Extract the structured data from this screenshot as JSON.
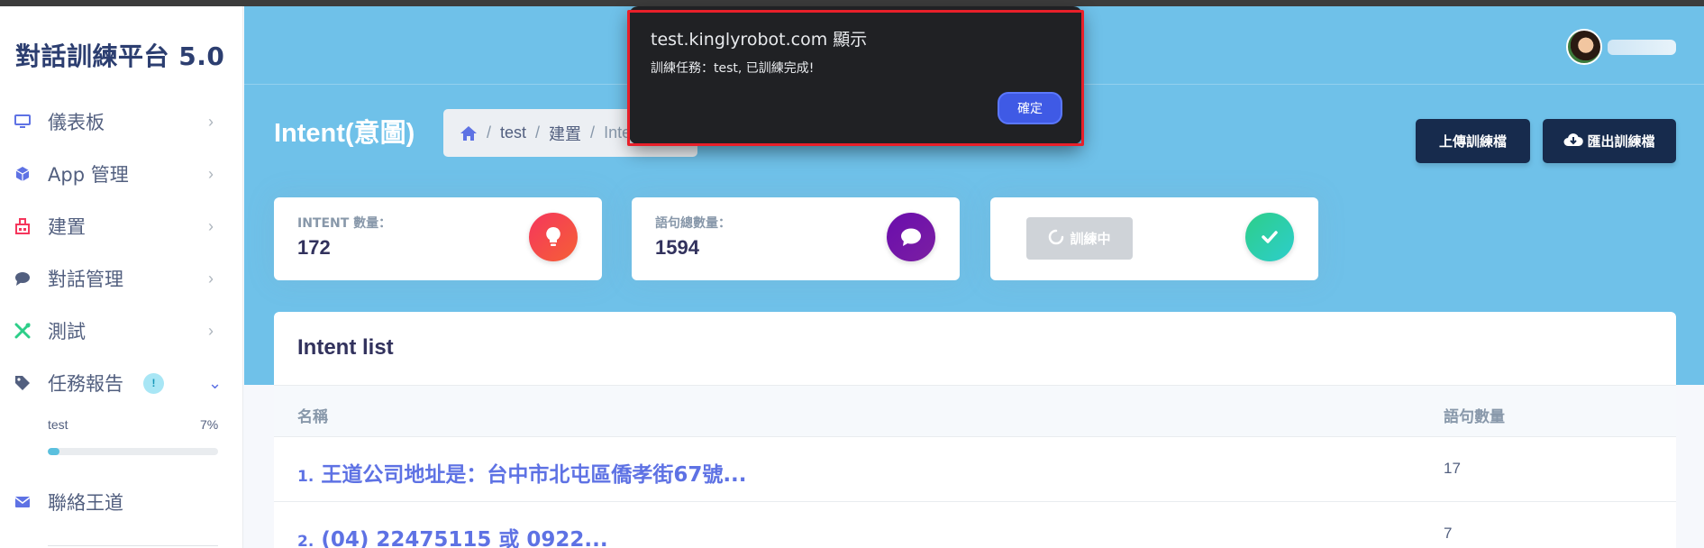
{
  "brand": "對話訓練平台 5.0",
  "sidebar": {
    "items": [
      {
        "label": "儀表板",
        "icon": "monitor-icon",
        "color": "#5e72e4"
      },
      {
        "label": "App 管理",
        "icon": "cube-icon",
        "color": "#5e72e4"
      },
      {
        "label": "建置",
        "icon": "building-icon",
        "color": "#f5365c"
      },
      {
        "label": "對話管理",
        "icon": "chat-icon",
        "color": "#525f7f"
      },
      {
        "label": "測試",
        "icon": "tools-icon",
        "color": "#2dce89"
      },
      {
        "label": "任務報告",
        "icon": "tag-icon",
        "color": "#525f7f",
        "badge": "!"
      },
      {
        "label": "聯絡王道",
        "icon": "envelope-icon",
        "color": "#5e72e4"
      }
    ],
    "task": {
      "name": "test",
      "percent_label": "7%",
      "progress": 0.07
    }
  },
  "header": {
    "title": "Intent(意圖)",
    "breadcrumb": [
      "test",
      "建置",
      "Intent"
    ],
    "upload_label": "上傳訓練檔",
    "export_label": "匯出訓練檔"
  },
  "stats": [
    {
      "title": "INTENT 數量：",
      "value": "172",
      "icon": "lightbulb-icon"
    },
    {
      "title": "語句總數量：",
      "value": "1594",
      "icon": "comment-icon"
    },
    {
      "button_label": "訓練中",
      "icon": "check-icon"
    }
  ],
  "intent_list": {
    "title": "Intent list",
    "columns": [
      "名稱",
      "語句數量"
    ],
    "rows": [
      {
        "num": "1.",
        "name": "王道公司地址是：台中市北屯區僑孝街67號...",
        "count": "17"
      },
      {
        "num": "2.",
        "name": "(04) 22475115 或 0922...",
        "count": "7"
      }
    ]
  },
  "dialog": {
    "title": "test.kinglyrobot.com 顯示",
    "message": "訓練任務：test, 已訓練完成!",
    "ok_label": "確定"
  }
}
